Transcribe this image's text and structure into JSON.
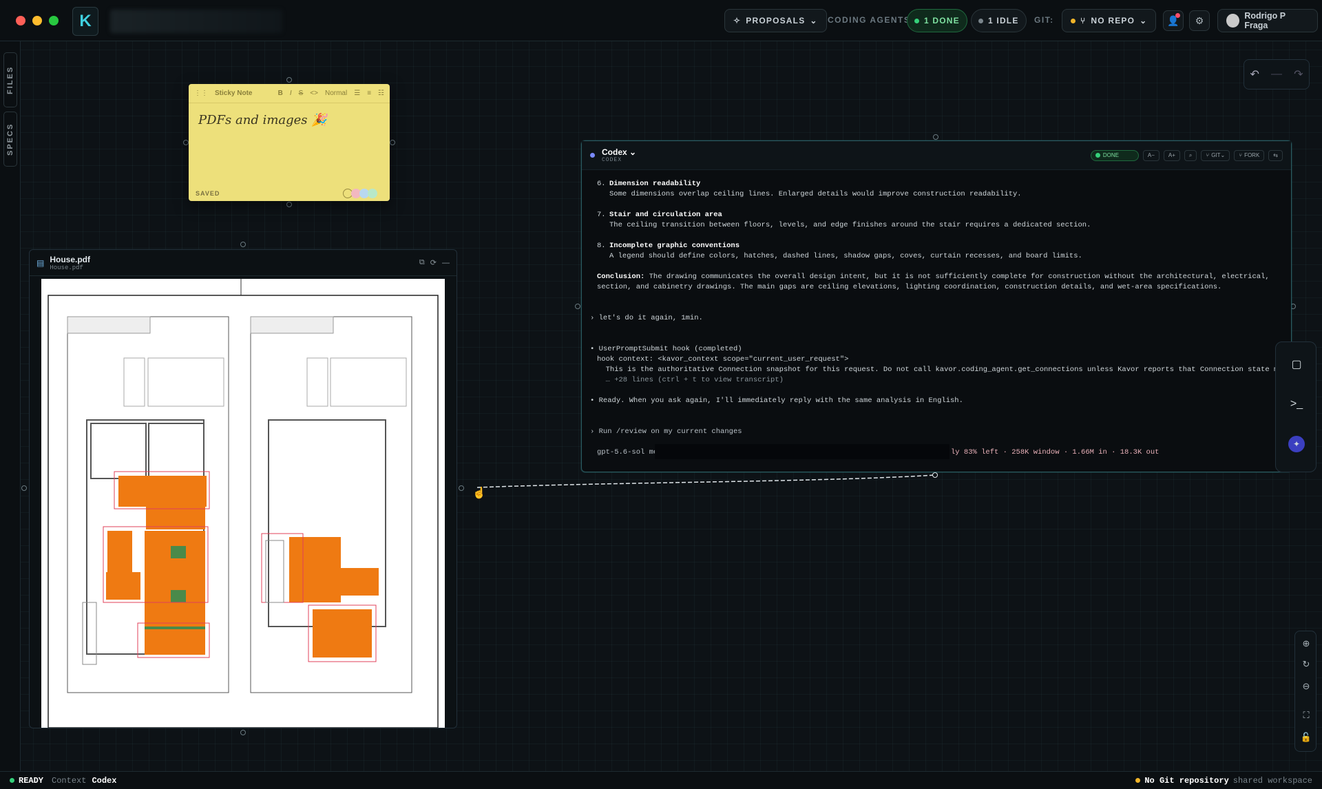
{
  "topbar": {
    "proposals": "PROPOSALS",
    "coding_agents_label": "CODING AGENTS:",
    "done": "1 DONE",
    "idle": "1 IDLE",
    "git_label": "GIT:",
    "no_repo": "NO REPO",
    "user": "Rodrigo P Fraga",
    "logo": "K"
  },
  "sidebar": {
    "files": "FILES",
    "specs": "SPECS"
  },
  "sticky": {
    "title": "Sticky Note",
    "format": "Normal",
    "text": "PDFs and images 🎉",
    "saved": "SAVED"
  },
  "pdf": {
    "title": "House.pdf",
    "subtitle": "House.pdf"
  },
  "codex": {
    "title": "Codex",
    "subtitle": "CODEX",
    "status": "DONE",
    "btn_fork": "FORK",
    "btn_git": "GIT",
    "lines": [
      {
        "n": "6.",
        "head": "Dimension readability",
        "body": "Some dimensions overlap ceiling lines. Enlarged details would improve construction readability."
      },
      {
        "n": "7.",
        "head": "Stair and circulation area",
        "body": "The ceiling transition between floors, levels, and edge finishes around the stair requires a dedicated section."
      },
      {
        "n": "8.",
        "head": "Incomplete graphic conventions",
        "body": "A legend should define colors, hatches, dashed lines, shadow gaps, coves, curtain recesses, and board limits."
      }
    ],
    "conclusion_label": "Conclusion:",
    "conclusion1": " The drawing communicates the overall design intent, but it is not sufficiently complete for construction without the architectural, electrical,",
    "conclusion2": "section, and cabinetry drawings. The main gaps are ceiling elevations, lighting coordination, construction details, and wet-area specifications.",
    "prompt1": "let's do it again, 1min.",
    "hook1": "UserPromptSubmit hook (completed)",
    "hook2": "hook context: <kavor_context scope=\"current_user_request\">",
    "hook3": "  This is the authoritative Connection snapshot for this request. Do not call kavor.coding_agent.get_connections unless Kavor reports that Connection state may",
    "hook4": "  … +28 lines (ctrl + t to view transcript)",
    "ready": "Ready. When you ask again, I'll immediately reply with the same analysis in English.",
    "input": "Run /review on my current changes",
    "model": "gpt-5.6-sol me",
    "usage": "ly 83% left · 258K window · 1.66M in · 18.3K out"
  },
  "status": {
    "ready": "READY",
    "context_label": "Context",
    "context": "Codex",
    "git": "No Git repository",
    "workspace": "shared workspace"
  }
}
